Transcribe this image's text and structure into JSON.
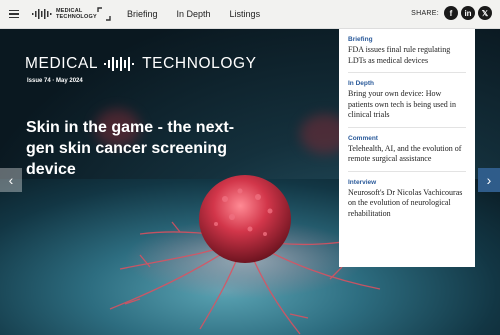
{
  "header": {
    "logo_line1": "MEDICAL",
    "logo_line2": "TECHNOLOGY",
    "nav": [
      {
        "label": "Briefing"
      },
      {
        "label": "In Depth"
      },
      {
        "label": "Listings"
      }
    ],
    "share_label": "SHARE:",
    "social": [
      {
        "icon": "facebook-icon",
        "glyph": "f"
      },
      {
        "icon": "linkedin-icon",
        "glyph": "in"
      },
      {
        "icon": "x-icon",
        "glyph": "𝕏"
      }
    ]
  },
  "hero": {
    "masthead_left": "MEDICAL",
    "masthead_right": "TECHNOLOGY",
    "issue": "Issue 74 · May 2024",
    "headline": "Skin in the game - the next-gen skin cancer screening device",
    "prev_arrow": "‹",
    "next_arrow": "›"
  },
  "panel": {
    "stories": [
      {
        "category": "Briefing",
        "title": "FDA issues final rule regulating LDTs as medical devices"
      },
      {
        "category": "In Depth",
        "title": "Bring your own device: How patients own tech is being used in clinical trials"
      },
      {
        "category": "Comment",
        "title": "Telehealth, AI, and the evolution of remote surgical assistance"
      },
      {
        "category": "Interview",
        "title": "Neurosoft's Dr Nicolas Vachicouras on the evolution of neurological rehabilitation"
      }
    ]
  },
  "colors": {
    "accent_blue": "#2a5a9a",
    "arrow_blue": "#2f5c8a",
    "cell_red": "#d2364a"
  }
}
